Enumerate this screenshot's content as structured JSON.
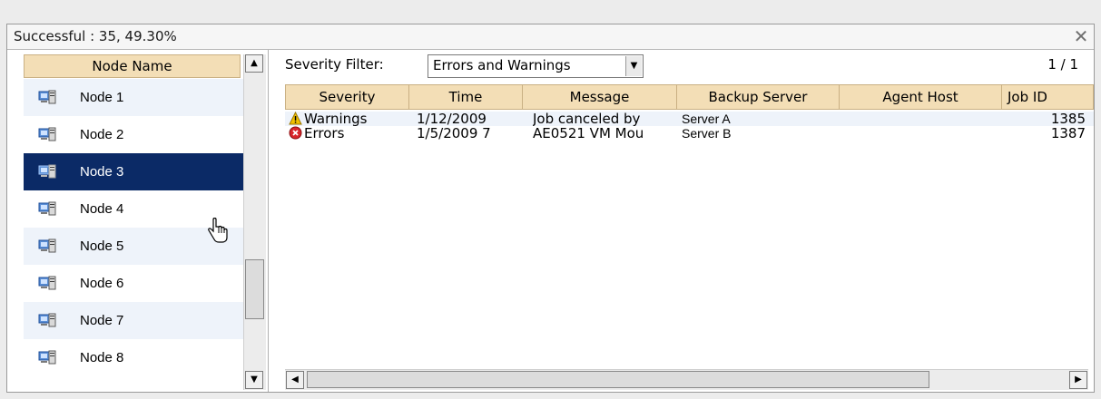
{
  "titlebar": {
    "title": "Successful : 35, 49.30%",
    "close_glyph": "✕"
  },
  "left_pane": {
    "header": "Node Name",
    "nodes": [
      {
        "label": "Node 1",
        "selected": false
      },
      {
        "label": "Node 2",
        "selected": false
      },
      {
        "label": "Node 3",
        "selected": true
      },
      {
        "label": "Node 4",
        "selected": false
      },
      {
        "label": "Node 5",
        "selected": false
      },
      {
        "label": "Node 6",
        "selected": false
      },
      {
        "label": "Node 7",
        "selected": false
      },
      {
        "label": "Node 8",
        "selected": false
      }
    ],
    "scroll_up": "▲",
    "scroll_down": "▼"
  },
  "right_pane": {
    "filter_label": "Severity Filter:",
    "filter_value": "Errors and Warnings",
    "filter_arrow": "▼",
    "pager": "1 / 1",
    "columns": [
      "Severity",
      "Time",
      "Message",
      "Backup Server",
      "Agent Host",
      "Job ID"
    ],
    "rows": [
      {
        "severity": "Warnings",
        "severity_icon": "warning-icon",
        "time": "1/12/2009",
        "message": "Job canceled by",
        "backup_server": "Server A",
        "agent_host": "",
        "job_id": "1385"
      },
      {
        "severity": "Errors",
        "severity_icon": "error-icon",
        "time": "1/5/2009 7",
        "message": "AE0521 VM Mou",
        "backup_server": "Server B",
        "agent_host": "",
        "job_id": "1387"
      }
    ],
    "hscroll_left": "◀",
    "hscroll_right": "▶"
  },
  "colors": {
    "header_bg": "#f3deb6",
    "selected_bg": "#0b2a66",
    "alt_row_bg": "#eef3fa",
    "warning": "#f2c200",
    "error": "#d8262b"
  }
}
